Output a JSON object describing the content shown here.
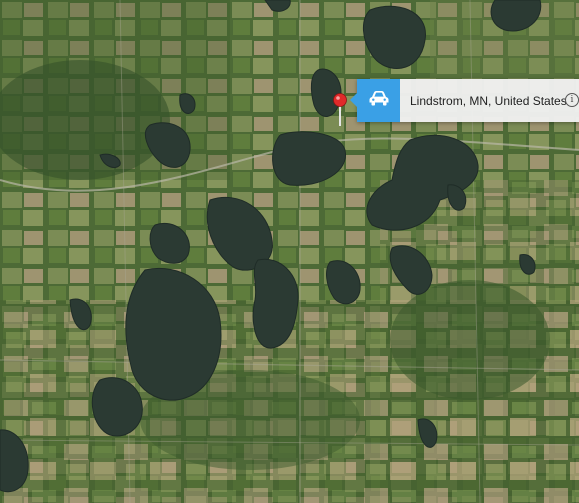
{
  "map": {
    "view": "satellite",
    "colors": {
      "water": "#2b3a33",
      "forest": "#3c5a2c",
      "field_light": "#a99c74",
      "field_green": "#6f8a4a",
      "accent": "#3aa0e6",
      "pin": "#e02a2a"
    }
  },
  "pin": {
    "icon": "map-pin-icon"
  },
  "callout": {
    "place_label": "Lindstrom, MN, United States",
    "route_icon": "car-icon",
    "info_glyph": "i",
    "info_icon": "info-icon"
  }
}
